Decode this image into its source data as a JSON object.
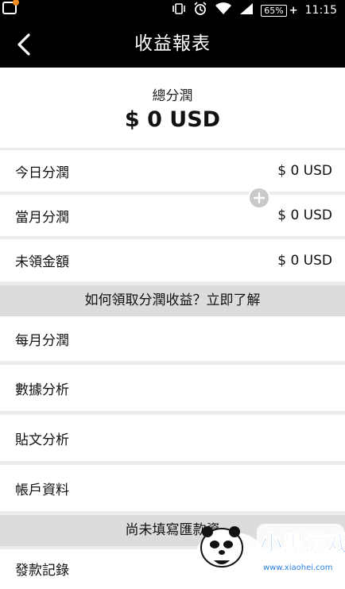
{
  "status_bar": {
    "battery": "65%",
    "time": "11:15",
    "icons": [
      "notification-icon",
      "vibrate-icon",
      "alarm-icon",
      "wifi-icon",
      "signal-icon",
      "battery-icon"
    ]
  },
  "header": {
    "title": "收益報表",
    "back_icon": "back-arrow-icon"
  },
  "summary": {
    "label": "總分潤",
    "value": "$ 0 USD"
  },
  "stats": [
    {
      "label": "今日分潤",
      "value": "$ 0 USD"
    },
    {
      "label": "當月分潤",
      "value": "$ 0 USD"
    },
    {
      "label": "未領金額",
      "value": "$ 0 USD"
    }
  ],
  "info_banner": "如何領取分潤收益？立即了解",
  "menu": [
    {
      "label": "每月分潤"
    },
    {
      "label": "數據分析"
    },
    {
      "label": "貼文分析"
    },
    {
      "label": "帳戶資料"
    }
  ],
  "notice_banner": "尚未填寫匯款資",
  "last_item": "發款記錄",
  "watermark": {
    "brand": "小黑游戏",
    "url": "www.xiaohei.com"
  },
  "colors": {
    "bar": "#000000",
    "card": "#ffffff",
    "banner": "#dcdcdc",
    "background": "#ececec",
    "watermark_blue": "#2a7fe0"
  }
}
